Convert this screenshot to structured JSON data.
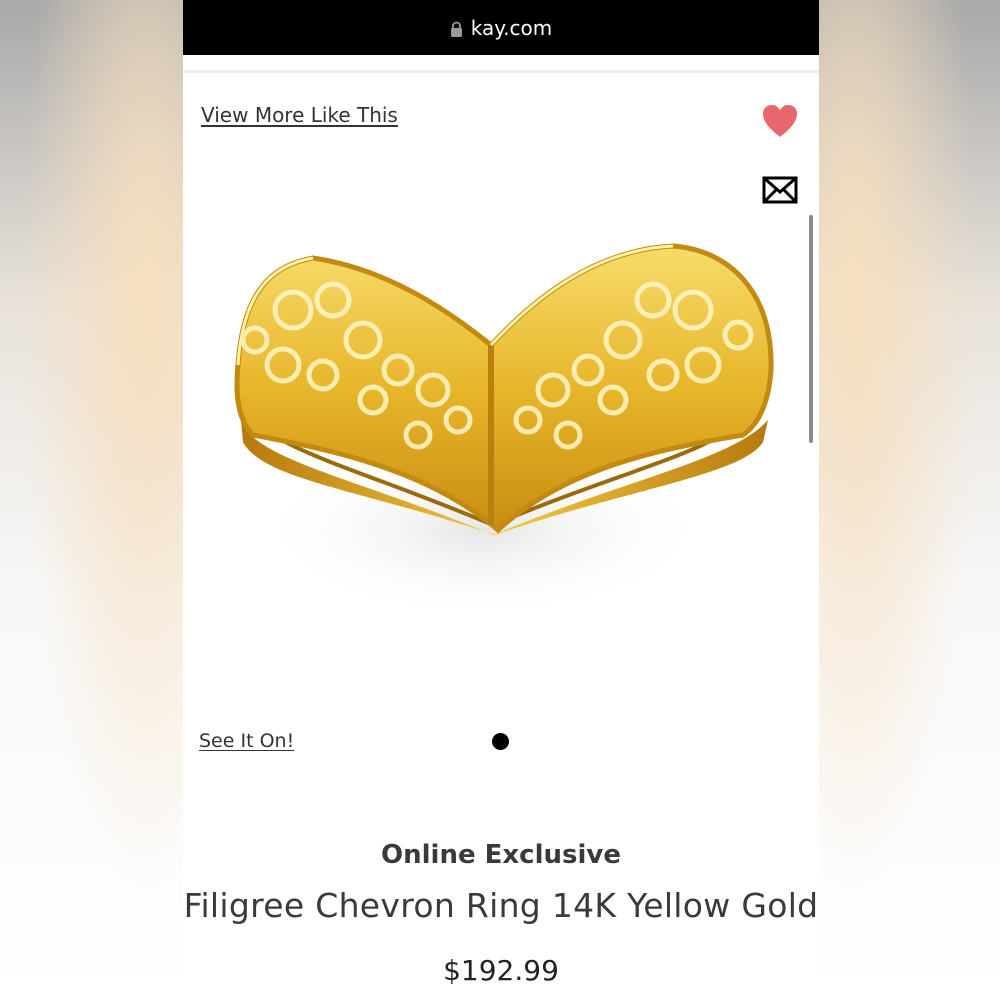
{
  "browser": {
    "url": "kay.com",
    "lock_icon": "lock-icon"
  },
  "actions": {
    "view_more": "View More Like This",
    "favorite_icon": "heart-icon",
    "favorite_color": "#e8676f",
    "share_icon": "mail-icon"
  },
  "gallery": {
    "see_it_on": "See It On!",
    "active_slide": 1
  },
  "product": {
    "badge": "Online Exclusive",
    "title": "Filigree Chevron Ring 14K Yellow Gold",
    "price": "$192.99"
  }
}
